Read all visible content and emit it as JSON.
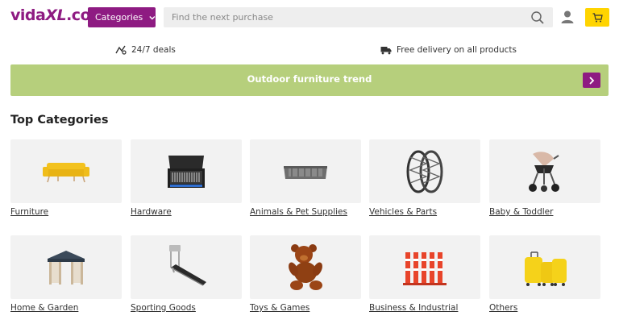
{
  "header": {
    "logo_text": "vidaXL.com",
    "categories_label": "Categories",
    "search_placeholder": "Find the next purchase",
    "brand_color": "#8e1b82",
    "cart_color": "#ffd400"
  },
  "usps": [
    {
      "icon": "deals-icon",
      "text": "24/7 deals"
    },
    {
      "icon": "truck-icon",
      "text": "Free delivery on all products"
    }
  ],
  "banner": {
    "text": "Outdoor furniture trend",
    "color": "#b6cf7c"
  },
  "section": {
    "title": "Top Categories"
  },
  "categories": [
    {
      "label": "Furniture",
      "icon": "yellow-sofa"
    },
    {
      "label": "Hardware",
      "icon": "tool-case"
    },
    {
      "label": "Animals & Pet Supplies",
      "icon": "pet-bed"
    },
    {
      "label": "Vehicles & Parts",
      "icon": "snow-chains"
    },
    {
      "label": "Baby & Toddler",
      "icon": "stroller"
    },
    {
      "label": "Home & Garden",
      "icon": "gazebo"
    },
    {
      "label": "Sporting Goods",
      "icon": "treadmill"
    },
    {
      "label": "Toys & Games",
      "icon": "teddy-bear"
    },
    {
      "label": "Business & Industrial",
      "icon": "traffic-bollards"
    },
    {
      "label": "Others",
      "icon": "yellow-suitcases"
    }
  ]
}
